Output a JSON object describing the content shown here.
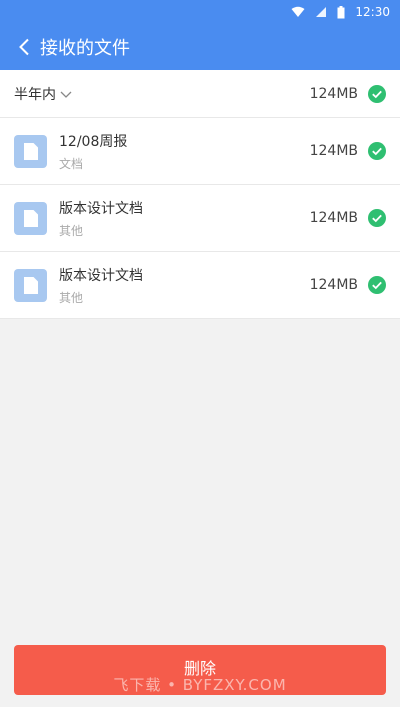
{
  "status_bar": {
    "time": "12:30",
    "icons": [
      "wifi-icon",
      "signal-icon",
      "battery-icon"
    ]
  },
  "header": {
    "title": "接收的文件"
  },
  "filter": {
    "label": "半年内",
    "total_size": "124MB"
  },
  "files": [
    {
      "name": "12/08周报",
      "type": "文档",
      "size": "124MB"
    },
    {
      "name": "版本设计文档",
      "type": "其他",
      "size": "124MB"
    },
    {
      "name": "版本设计文档",
      "type": "其他",
      "size": "124MB"
    }
  ],
  "footer": {
    "delete_label": "删除",
    "watermark": "飞下载 • BYFZXY.COM"
  },
  "colors": {
    "primary": "#4a8cf0",
    "check": "#2fbf71",
    "danger": "#f55c4b",
    "file_icon": "#a8c8f0"
  }
}
